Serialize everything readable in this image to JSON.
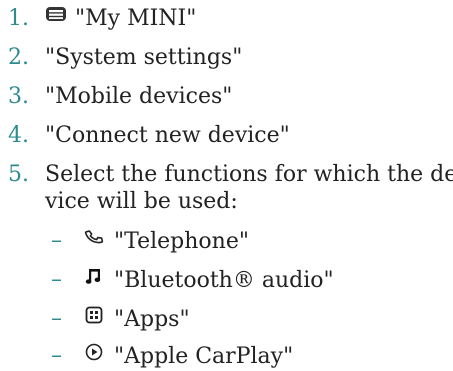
{
  "steps": [
    {
      "num": "1.",
      "icon": "car-menu-icon",
      "text": "\"My MINI\""
    },
    {
      "num": "2.",
      "text": "\"System settings\""
    },
    {
      "num": "3.",
      "text": "\"Mobile devices\""
    },
    {
      "num": "4.",
      "text": "\"Connect new device\""
    },
    {
      "num": "5.",
      "text_line1": "Select the functions for which the de-",
      "text_line2": "vice will be used:"
    }
  ],
  "functions": [
    {
      "bullet": "–",
      "icon": "telephone-icon",
      "text": "\"Telephone\""
    },
    {
      "bullet": "–",
      "icon": "music-note-icon",
      "text": "\"Bluetooth® audio\""
    },
    {
      "bullet": "–",
      "icon": "apps-icon",
      "text": "\"Apps\""
    },
    {
      "bullet": "–",
      "icon": "apple-carplay-icon",
      "text": "\"Apple CarPlay\""
    }
  ],
  "colors": {
    "number": "#2f8b8f",
    "text": "#222222"
  }
}
